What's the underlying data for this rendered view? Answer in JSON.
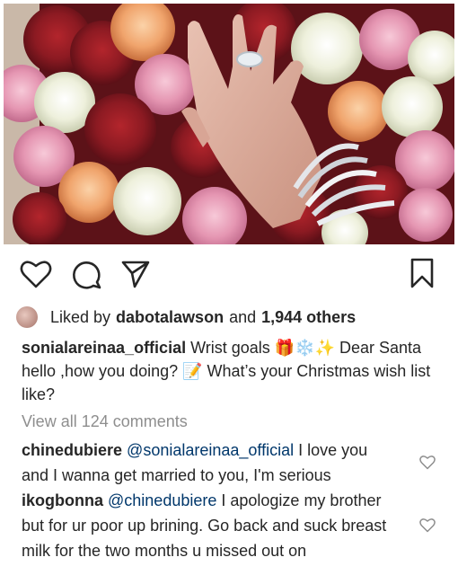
{
  "post": {
    "image_alt": "hand with diamond ring and bracelets on roses"
  },
  "actions": {
    "like_icon": "heart-icon",
    "comment_icon": "comment-bubble-icon",
    "share_icon": "paper-plane-icon",
    "save_icon": "bookmark-icon"
  },
  "likes": {
    "prefix": "Liked by",
    "user": "dabotalawson",
    "conjunction": "and",
    "others": "1,944 others"
  },
  "caption": {
    "username": "sonialareinaa_official",
    "text": " Wrist goals 🎁❄️✨ Dear Santa hello ,how you doing? 📝 What’s your Christmas wish list like?"
  },
  "comments_link": "View all 124 comments",
  "comments": [
    {
      "username": "chinedubiere",
      "mention": "@sonialareinaa_official",
      "text": " I love you and I wanna get married to you, I'm serious"
    },
    {
      "username": "ikogbonna",
      "mention": "@chinedubiere",
      "text": " I apologize my brother but for ur poor up brining. Go back and suck breast milk for the two months u missed out on"
    }
  ],
  "colors": {
    "text": "#262626",
    "muted": "#8e8e8e",
    "mention": "#00376b"
  }
}
